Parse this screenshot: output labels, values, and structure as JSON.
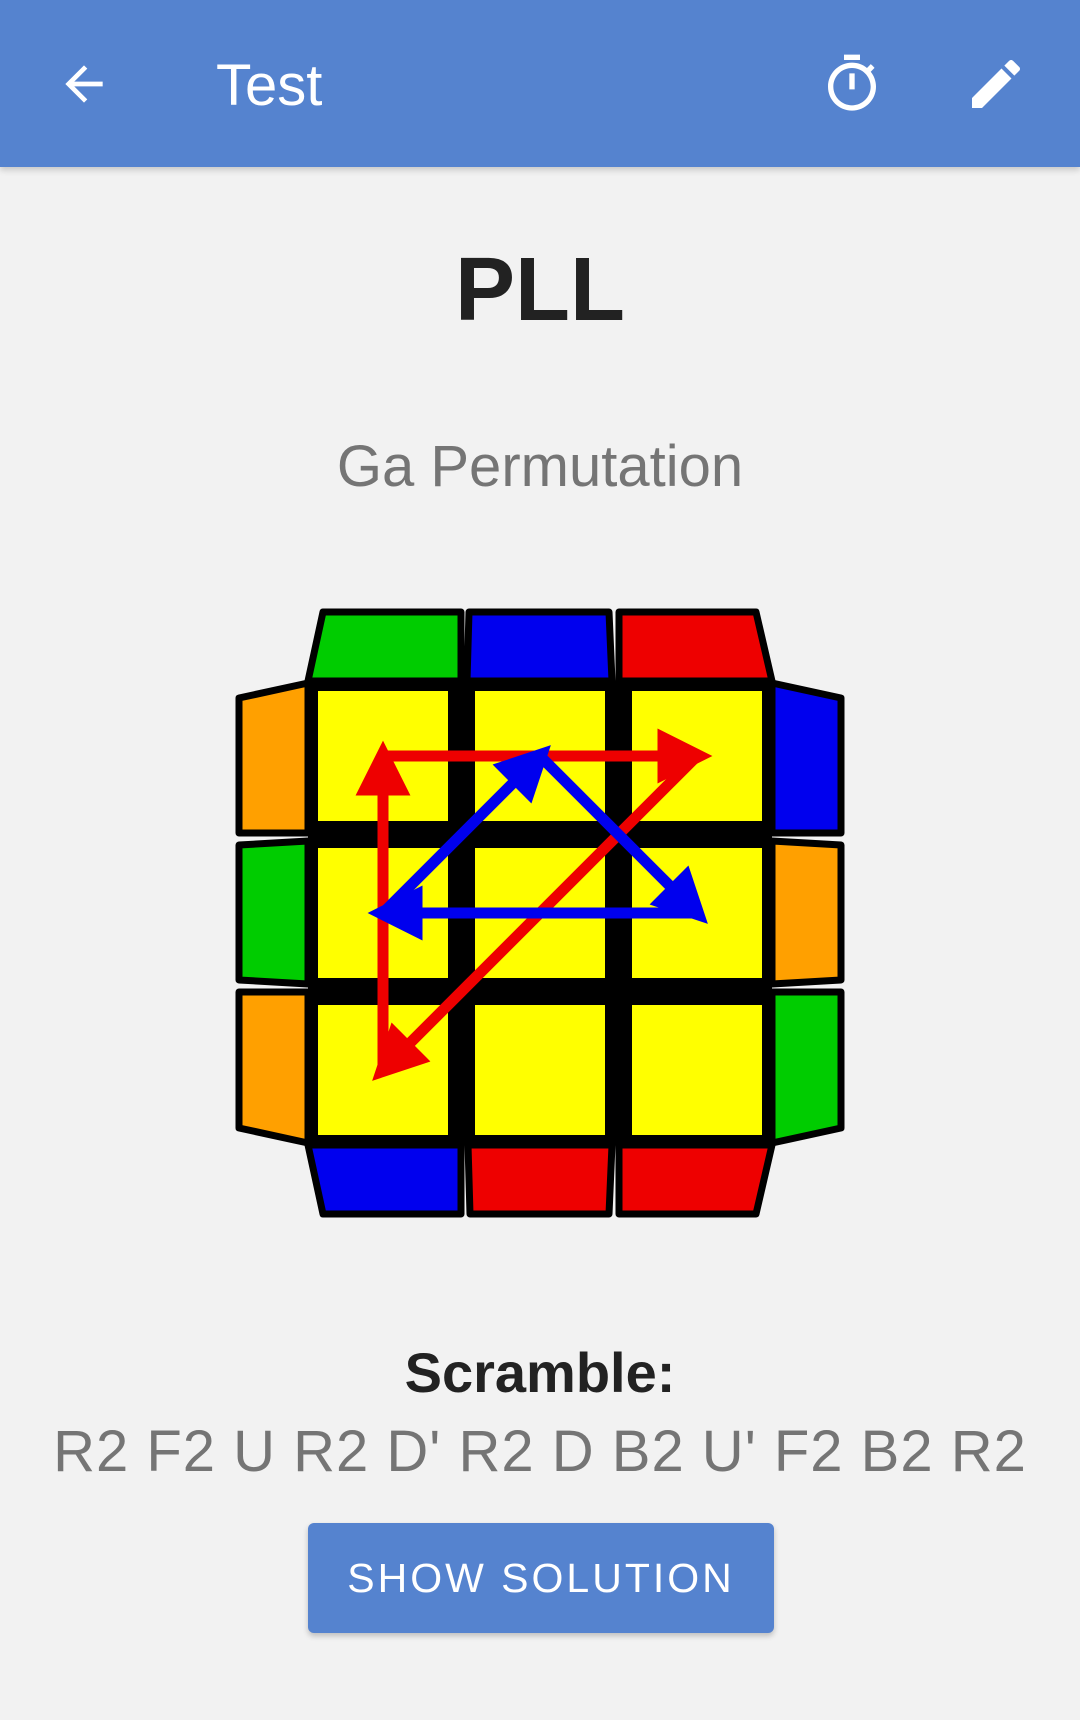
{
  "appbar": {
    "title": "Test",
    "back_icon": "arrow-back-icon",
    "timer_icon": "timer-icon",
    "edit_icon": "pencil-icon",
    "color": "#5583cf"
  },
  "case": {
    "group": "PLL",
    "name": "Ga Permutation"
  },
  "cube_diagram": {
    "top_face": [
      [
        "yellow",
        "yellow",
        "yellow"
      ],
      [
        "yellow",
        "yellow",
        "yellow"
      ],
      [
        "yellow",
        "yellow",
        "yellow"
      ]
    ],
    "back_edge": [
      "green",
      "blue",
      "red"
    ],
    "front_edge": [
      "blue",
      "red",
      "red"
    ],
    "left_edge": [
      "orange",
      "green",
      "orange"
    ],
    "right_edge": [
      "blue",
      "orange",
      "green"
    ],
    "arrow_colors": {
      "corner_cycle": "#ee0000",
      "edge_cycle": "#0000ee"
    }
  },
  "scramble": {
    "label": "Scramble:",
    "moves": "R2 F2 U R2 D' R2 D B2 U' F2 B2 R2"
  },
  "actions": {
    "show_solution": "SHOW SOLUTION"
  }
}
